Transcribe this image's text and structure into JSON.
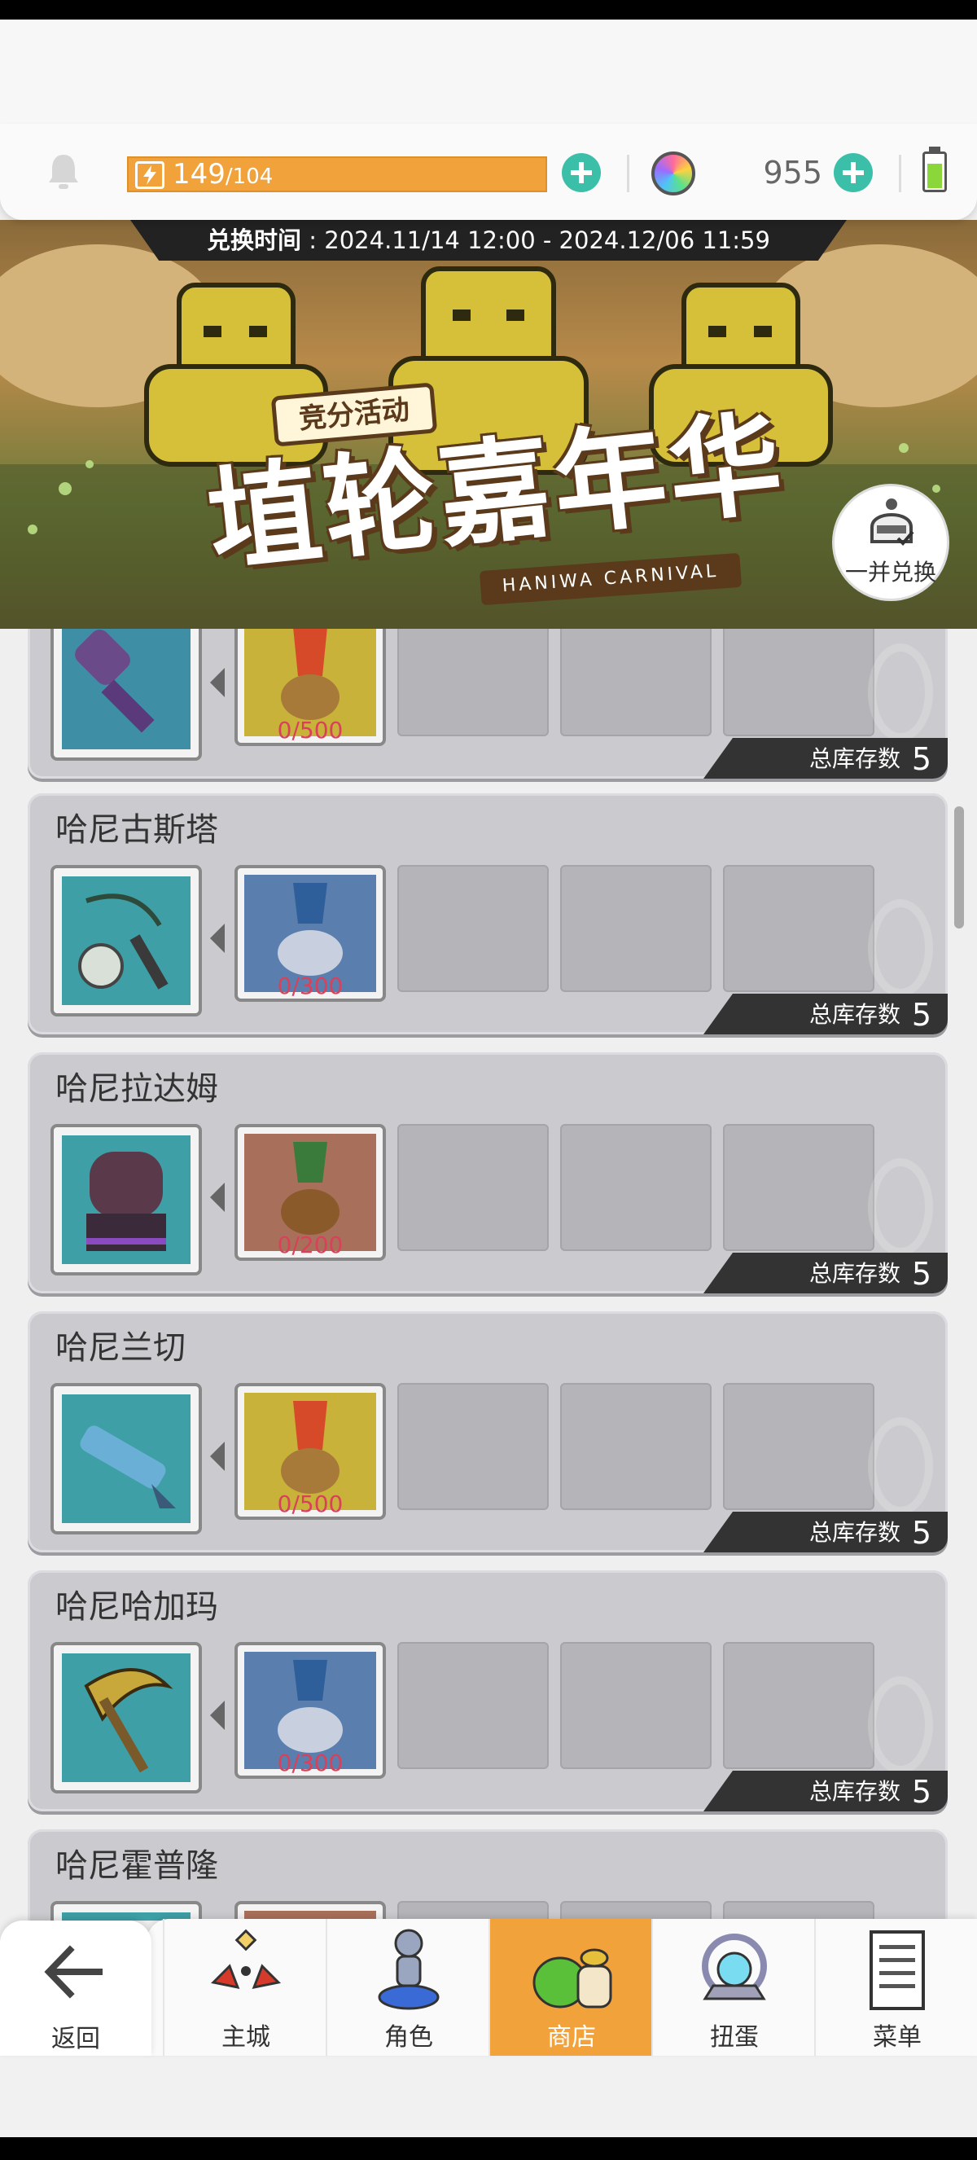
{
  "resources": {
    "energy_current": "149",
    "energy_max": "/104",
    "gem_count": "955"
  },
  "banner": {
    "period_label": "兑换时间",
    "period_value": " : 2024.11/14 12:00 - 2024.12/06 11:59",
    "badge": "竞分活动",
    "title": "埴轮嘉年华",
    "subtitle": "HANIWA CARNIVAL",
    "bulk_exchange": "一并兑换"
  },
  "items": [
    {
      "name": "",
      "cost": "0/500",
      "stock_label": "总库存数",
      "stock": "5",
      "reward_icon": "purple-mace-icon",
      "cost_icon": "gold-haniwa-token-icon"
    },
    {
      "name": "哈尼古斯塔",
      "cost": "0/300",
      "stock_label": "总库存数",
      "stock": "5",
      "reward_icon": "flail-icon",
      "cost_icon": "blue-haniwa-token-icon"
    },
    {
      "name": "哈尼拉达姆",
      "cost": "0/200",
      "stock_label": "总库存数",
      "stock": "5",
      "reward_icon": "haniwa-statue-icon",
      "cost_icon": "brown-haniwa-token-icon"
    },
    {
      "name": "哈尼兰切",
      "cost": "0/500",
      "stock_label": "总库存数",
      "stock": "5",
      "reward_icon": "lance-icon",
      "cost_icon": "gold-haniwa-token-icon"
    },
    {
      "name": "哈尼哈加玛",
      "cost": "0/300",
      "stock_label": "总库存数",
      "stock": "5",
      "reward_icon": "scythe-icon",
      "cost_icon": "blue-haniwa-token-icon"
    },
    {
      "name": "哈尼霍普隆",
      "cost": "",
      "stock_label": "",
      "stock": "",
      "reward_icon": "weapon-icon",
      "cost_icon": "brown-haniwa-token-icon"
    }
  ],
  "nav": {
    "back": "返回",
    "items": [
      {
        "label": "主城",
        "icon": "castle-icon"
      },
      {
        "label": "角色",
        "icon": "character-icon"
      },
      {
        "label": "商店",
        "icon": "shop-icon",
        "active": true
      },
      {
        "label": "扭蛋",
        "icon": "gacha-icon"
      },
      {
        "label": "菜单",
        "icon": "menu-icon"
      }
    ]
  },
  "colors": {
    "accent_orange": "#f2a23a",
    "plus_teal": "#3bbfa8",
    "cost_red": "#d9415a"
  }
}
